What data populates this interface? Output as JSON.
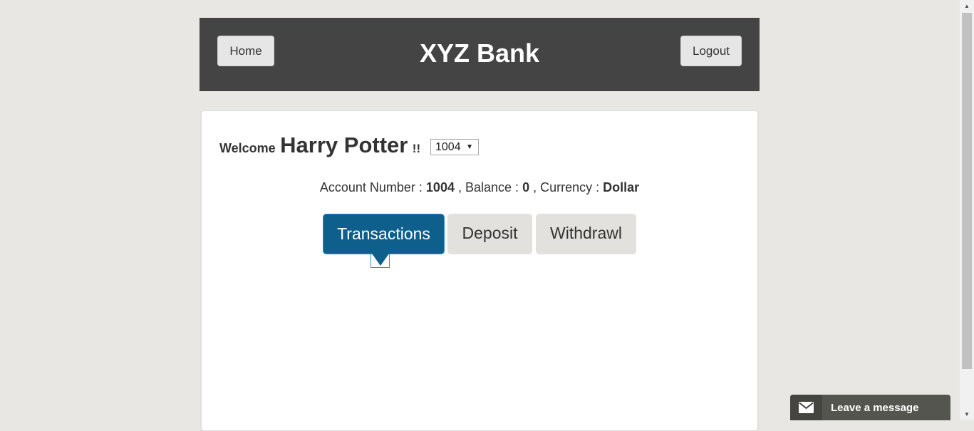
{
  "header": {
    "home_label": "Home",
    "title": "XYZ Bank",
    "logout_label": "Logout",
    "background_color": "#444444"
  },
  "customer": {
    "welcome_label": "Welcome",
    "name": "Harry Potter",
    "exclaim": "!!",
    "selected_account": "1004"
  },
  "account_info": {
    "account_number_label": "Account Number :",
    "account_number": "1004",
    "balance_sep": ", Balance :",
    "balance": "0",
    "currency_sep": ", Currency :",
    "currency": "Dollar"
  },
  "tabs": [
    {
      "label": "Transactions",
      "active": true
    },
    {
      "label": "Deposit",
      "active": false
    },
    {
      "label": "Withdrawl",
      "active": false
    }
  ],
  "chat": {
    "label": "Leave a message",
    "icon": "envelope-icon"
  },
  "colors": {
    "accent": "#0e5f8c",
    "page_background": "#e9e7e3"
  }
}
